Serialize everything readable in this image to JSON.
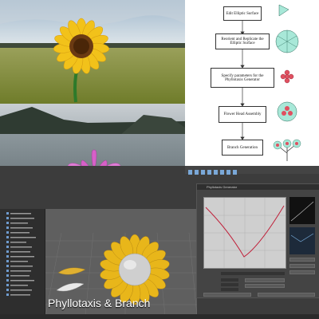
{
  "flowchart": {
    "steps": [
      "Edit Elliptic Surface",
      "Reorient and Replicate the Elliptic Surface",
      "Specify parameters for the Phyllotaxis Generator",
      "Flower Head Assembly",
      "Branch Generation"
    ]
  },
  "maya": {
    "editor_title": "Phyllotaxis Generator",
    "caption": "Phyllotaxis & Branch"
  },
  "colors": {
    "petal_yellow": "#f2c21a",
    "lotus_pink": "#d760c8",
    "diagram_teal": "#a8e8d8",
    "diagram_red": "#e05060",
    "curve_red": "#c0203a"
  }
}
